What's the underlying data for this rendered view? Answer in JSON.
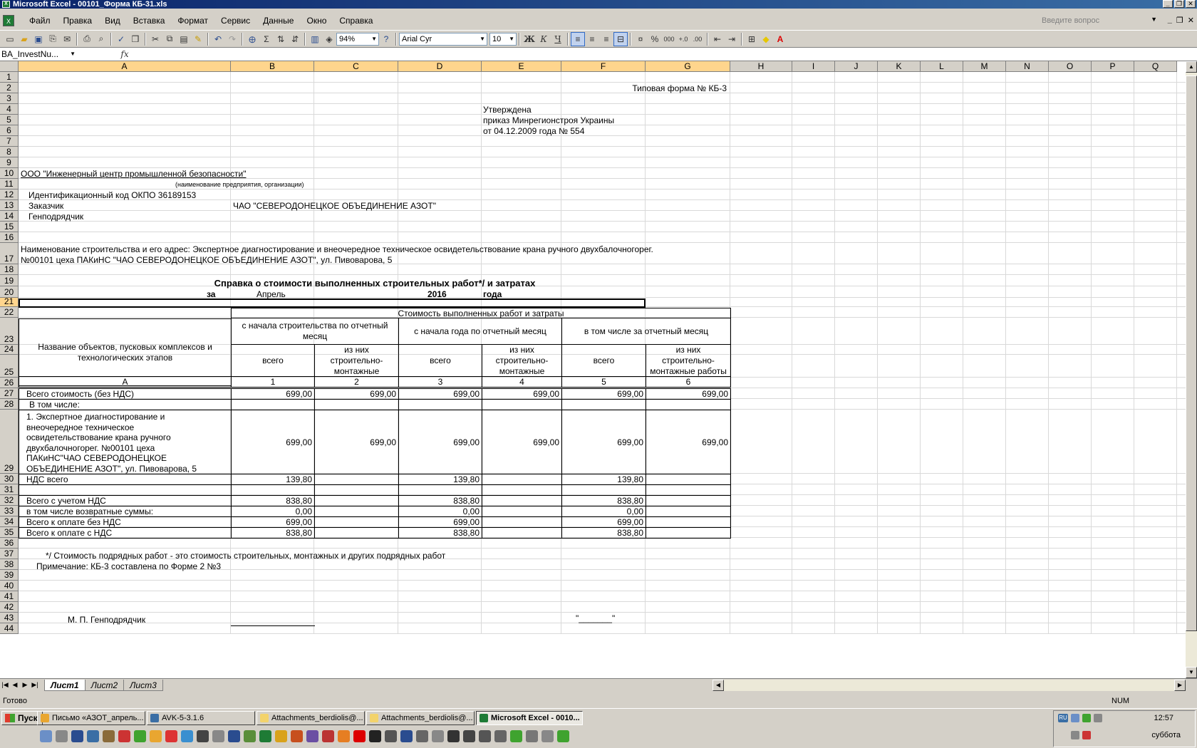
{
  "window": {
    "title": "Microsoft Excel - 00101_Форма КБ-31.xls",
    "app_icon": "X"
  },
  "menu": {
    "items": [
      "Файл",
      "Правка",
      "Вид",
      "Вставка",
      "Формат",
      "Сервис",
      "Данные",
      "Окно",
      "Справка"
    ],
    "help_placeholder": "Введите вопрос"
  },
  "toolbar": {
    "zoom": "94%",
    "font_name": "Arial Cyr",
    "font_size": "10",
    "bold_label": "Ж",
    "italic_label": "К",
    "underline_label": "Ч",
    "percent_label": "%",
    "thousands_label": "000",
    "sigma_label": "Σ"
  },
  "formula_bar": {
    "name_box": "BA_InvestNu...",
    "fx_label": "fx"
  },
  "columns": [
    "A",
    "B",
    "C",
    "D",
    "E",
    "F",
    "G",
    "H",
    "I",
    "J",
    "K",
    "L",
    "M",
    "N",
    "O",
    "P",
    "Q"
  ],
  "rows": [
    "1",
    "2",
    "3",
    "4",
    "5",
    "6",
    "7",
    "8",
    "9",
    "10",
    "11",
    "12",
    "13",
    "14",
    "15",
    "16",
    "17",
    "18",
    "19",
    "20",
    "21",
    "22",
    "23",
    "24",
    "25",
    "26",
    "27",
    "28",
    "29",
    "30",
    "31",
    "32",
    "33",
    "34",
    "35",
    "36",
    "37",
    "38",
    "39",
    "40",
    "41",
    "42",
    "43",
    "44"
  ],
  "sheet": {
    "form_type": "Типовая форма № КБ-3",
    "approved": "Утверждена",
    "approved_by": "приказ Минрегионстроя Украины",
    "approved_date": "от 04.12.2009 года  № 554",
    "contractor_org": "ООО \"Инженерный центр промышленной безопасности\"",
    "org_caption": "(наименование предприятия, организации)",
    "okpo": "Идентификационный код ОКПО  36189153",
    "customer_label": "Заказчик",
    "customer_value": "ЧАО \"СЕВЕРОДОНЕЦКОЕ ОБЪЕДИНЕНИЕ АЗОТ\"",
    "gencontractor_label": "Генподрядчик",
    "construction_line1": "Наименование строительства и его адрес: Экспертное диагностирование и внеочередное техническое освидетельствование крана ручного двухбалочногорег.",
    "construction_line2": "№00101 цеха ПАКиНС \"ЧАО СЕВЕРОДОНЕЦКОЕ ОБЪЕДИНЕНИЕ АЗОТ\", ул. Пивоварова, 5",
    "report_title": "Справка о стоимости выполненных строительных работ*/ и затратах",
    "period_for": "за",
    "period_month": "Апрель",
    "period_year": "2016",
    "period_year_word": "года",
    "hdr_cost": "Стоимость выполненных работ и затраты",
    "hdr_objects": "Название объектов, пусковых комплексов и технологических этапов",
    "hdr_from_start": "с начала строительства по отчетный месяц",
    "hdr_from_year": "с начала года по отчетный месяц",
    "hdr_month": "в том числе за отчетный месяц",
    "hdr_total": "всего",
    "hdr_of_which": "из них строительно-монтажные",
    "hdr_of_which_works": "из них строительно-монтажные работы",
    "col_nums": [
      "А",
      "1",
      "2",
      "3",
      "4",
      "5",
      "6"
    ],
    "rows": [
      {
        "label": "Всего стоимость (без НДС)",
        "values": [
          "699,00",
          "699,00",
          "699,00",
          "699,00",
          "699,00",
          "699,00"
        ]
      },
      {
        "label": "В том числе:",
        "values": [
          "",
          "",
          "",
          "",
          "",
          ""
        ]
      },
      {
        "label": "1.  Экспертное диагностирование и внеочередное техническое освидетельствование крана ручного двухбалочногорег. №00101 цеха ПАКиНС\"ЧАО СЕВЕРОДОНЕЦКОЕ ОБЪЕДИНЕНИЕ АЗОТ\", ул. Пивоварова, 5",
        "values": [
          "699,00",
          "699,00",
          "699,00",
          "699,00",
          "699,00",
          "699,00"
        ]
      },
      {
        "label": "НДС всего",
        "values": [
          "139,80",
          "",
          "139,80",
          "",
          "139,80",
          ""
        ]
      },
      {
        "label": "",
        "values": [
          "",
          "",
          "",
          "",
          "",
          ""
        ]
      },
      {
        "label": "Всего с учетом НДС",
        "values": [
          "838,80",
          "",
          "838,80",
          "",
          "838,80",
          ""
        ]
      },
      {
        "label": "в том числе возвратные суммы:",
        "values": [
          "0,00",
          "",
          "0,00",
          "",
          "0,00",
          ""
        ]
      },
      {
        "label": "Всего к оплате без НДС",
        "values": [
          "699,00",
          "",
          "699,00",
          "",
          "699,00",
          ""
        ]
      },
      {
        "label": "Всего к оплате с НДС",
        "values": [
          "838,80",
          "",
          "838,80",
          "",
          "838,80",
          ""
        ]
      }
    ],
    "footnote": "*/ Стоимость подрядных работ - это стоимость строительных, монтажных и других подрядных работ",
    "note": "Примечание: КБ-3 составлена по Форме 2 №3",
    "sign_label": "М. П. Генподрядчик",
    "sign_date": "\"_______\""
  },
  "tabs": [
    "Лист1",
    "Лист2",
    "Лист3"
  ],
  "status": {
    "ready": "Готово",
    "num": "NUM"
  },
  "taskbar": {
    "start": "Пуск",
    "items": [
      {
        "label": "Письмо «АЗОТ_апрель...",
        "icon_color": "#e9a630"
      },
      {
        "label": "AVK-5-3.1.6",
        "icon_color": "#3a6ea5"
      },
      {
        "label": "Attachments_berdiolis@...",
        "icon_color": "#f3d36b"
      },
      {
        "label": "Attachments_berdiolis@...",
        "icon_color": "#f3d36b"
      },
      {
        "label": "Microsoft Excel - 0010...",
        "icon_color": "#1e7b35"
      }
    ],
    "time": "12:57",
    "day": "суббота",
    "lang": "RU"
  }
}
